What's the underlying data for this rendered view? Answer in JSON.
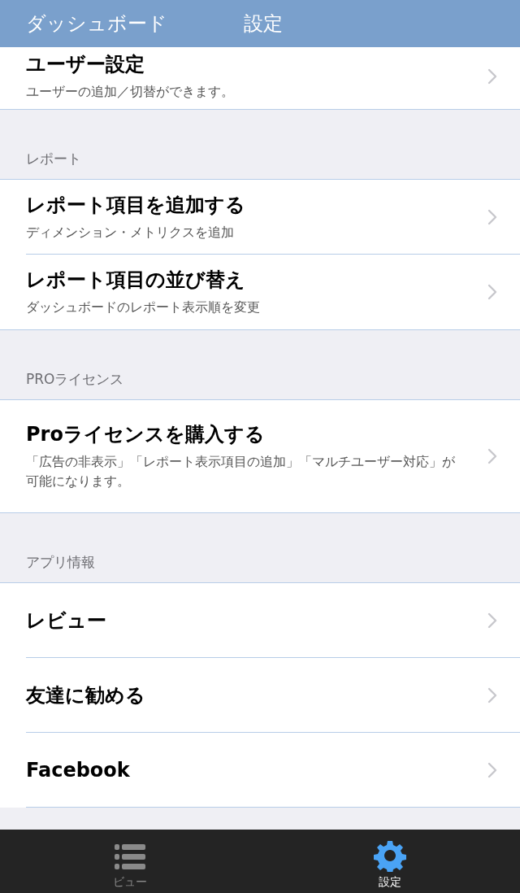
{
  "nav_bar": {
    "back_label": "ダッシュボード",
    "title": "設定"
  },
  "sections": [
    {
      "rows": [
        {
          "title": "ユーザー設定",
          "subtitle": "ユーザーの追加／切替ができます。"
        }
      ]
    },
    {
      "header": "レポート",
      "rows": [
        {
          "title": "レポート項目を追加する",
          "subtitle": "ディメンション・メトリクスを追加"
        },
        {
          "title": "レポート項目の並び替え",
          "subtitle": "ダッシュボードのレポート表示順を変更"
        }
      ]
    },
    {
      "header": "PROライセンス",
      "rows": [
        {
          "title": "Proライセンスを購入する",
          "subtitle": "「広告の非表示」「レポート表示項目の追加」「マルチユーザー対応」が可能になります。"
        }
      ]
    },
    {
      "header": "アプリ情報",
      "rows": [
        {
          "title": "レビュー"
        },
        {
          "title": "友達に勧める"
        },
        {
          "title": "Facebook"
        }
      ]
    }
  ],
  "tab_bar": [
    {
      "kind": "list",
      "label": "ビュー",
      "selected": false
    },
    {
      "kind": "gear",
      "label": "設定",
      "selected": true
    }
  ]
}
